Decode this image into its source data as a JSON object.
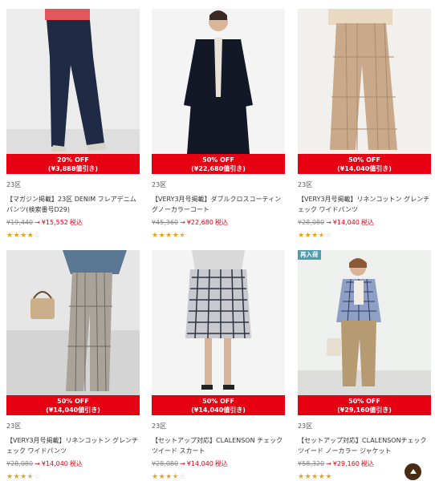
{
  "products": [
    {
      "discount": "20% OFF",
      "discount_amount": "(¥3,888値引き)",
      "brand": "23区",
      "name": "【マガジン掲載】23区 DENIM フレアデニムパンツ(検索番号D29)",
      "orig_price": "¥19,440",
      "arrow": "→",
      "sale_price": "¥15,552",
      "tax": "税込",
      "rating": 4,
      "badge": ""
    },
    {
      "discount": "50% OFF",
      "discount_amount": "(¥22,680値引き)",
      "brand": "23区",
      "name": "【VERY3月号掲載】ダブルクロスコーティングノーカラーコート",
      "orig_price": "¥45,360",
      "arrow": "→",
      "sale_price": "¥22,680",
      "tax": "税込",
      "rating": 4.5,
      "badge": ""
    },
    {
      "discount": "50% OFF",
      "discount_amount": "(¥14,040値引き)",
      "brand": "23区",
      "name": "【VERY3月号掲載】リネンコットン グレンチェック ワイドパンツ",
      "orig_price": "¥28,080",
      "arrow": "→",
      "sale_price": "¥14,040",
      "tax": "税込",
      "rating": 3.5,
      "badge": ""
    },
    {
      "discount": "50% OFF",
      "discount_amount": "(¥14,040値引き)",
      "brand": "23区",
      "name": "【VERY3月号掲載】リネンコットン グレンチェック ワイドパンツ",
      "orig_price": "¥28,080",
      "arrow": "→",
      "sale_price": "¥14,040",
      "tax": "税込",
      "rating": 3.5,
      "badge": ""
    },
    {
      "discount": "50% OFF",
      "discount_amount": "(¥14,040値引き)",
      "brand": "23区",
      "name": "【セットアップ対応】CLALENSON チェックツイード スカート",
      "orig_price": "¥28,080",
      "arrow": "→",
      "sale_price": "¥14,040",
      "tax": "税込",
      "rating": 3.5,
      "badge": ""
    },
    {
      "discount": "50% OFF",
      "discount_amount": "(¥29,160値引き)",
      "brand": "23区",
      "name": "【セットアップ対応】CLALENSONチェックツイード ノーカラー ジャケット",
      "orig_price": "¥58,320",
      "arrow": "→",
      "sale_price": "¥29,160",
      "tax": "税込",
      "rating": 5,
      "badge": "再入荷"
    }
  ],
  "colors": {
    "accent": "#e60012",
    "star": "#e8a317",
    "badge": "#4d9fae",
    "top_button": "#4a2b14"
  },
  "icons": {
    "back_to_top": "arrow-up-icon",
    "rating": "star-icon"
  }
}
